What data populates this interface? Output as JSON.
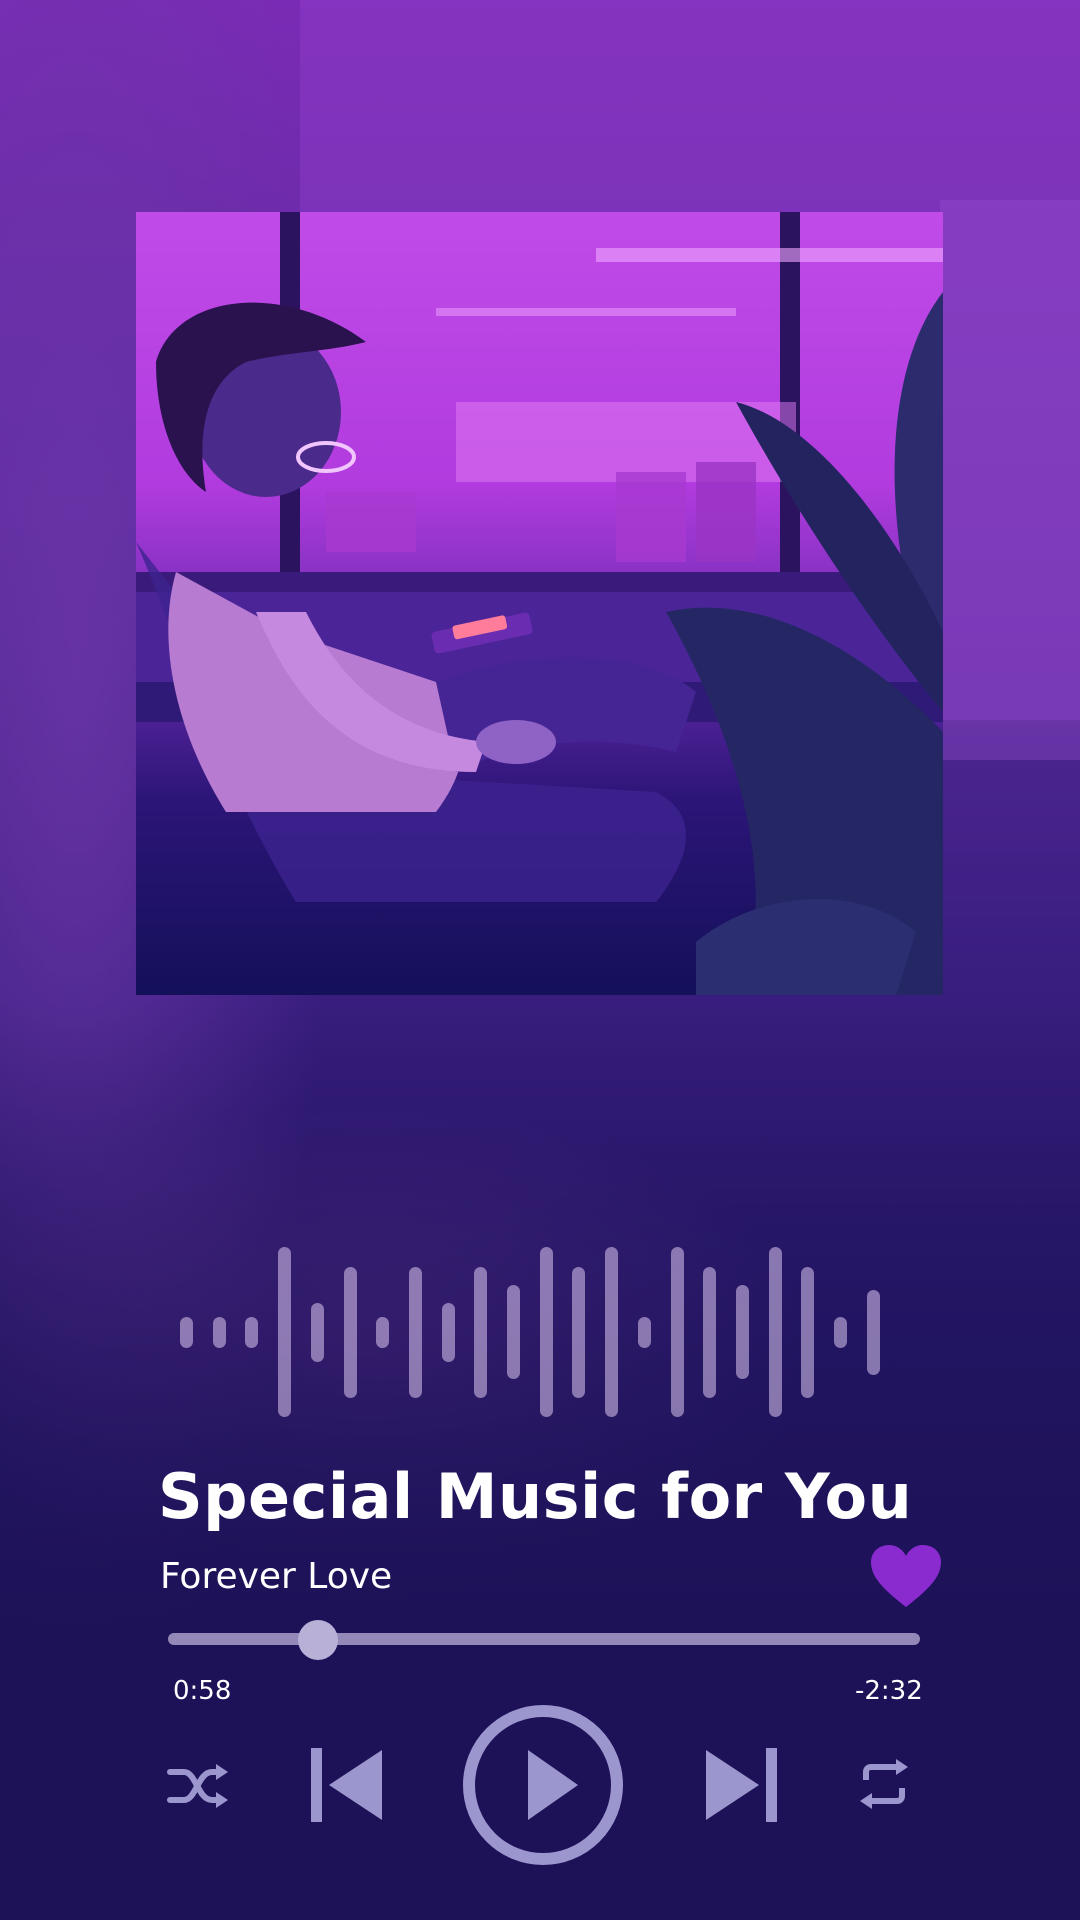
{
  "player": {
    "title": "Special Music for You",
    "artist": "Forever Love",
    "elapsed": "0:58",
    "remaining": "-2:32",
    "progress": 0.2,
    "liked": true
  },
  "waveform": {
    "levels": [
      0.18,
      0.18,
      0.18,
      1.0,
      0.35,
      0.77,
      0.18,
      0.77,
      0.35,
      0.77,
      0.55,
      1.0,
      0.77,
      1.0,
      0.18,
      1.0,
      0.77,
      0.55,
      1.0,
      0.77,
      0.18,
      0.5
    ]
  },
  "controls": {
    "shuffle_icon": "shuffle-icon",
    "previous_icon": "skip-previous-icon",
    "play_icon": "play-icon",
    "next_icon": "skip-next-icon",
    "repeat_icon": "repeat-icon"
  },
  "colors": {
    "accent": "#8a2bd0",
    "control": "#9c96cf",
    "background": "#201463"
  }
}
